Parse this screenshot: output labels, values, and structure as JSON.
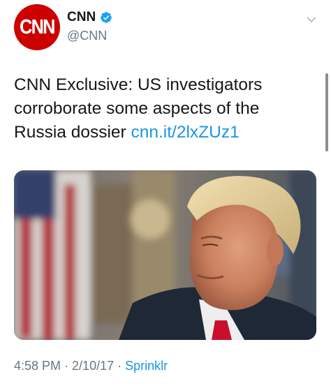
{
  "account": {
    "logo_text": "CNN",
    "name": "CNN",
    "handle": "@CNN"
  },
  "tweet": {
    "text": "CNN Exclusive: US investigators corroborate some aspects of the Russia dossier ",
    "link": "cnn.it/2lxZUz1"
  },
  "meta": {
    "time": "4:58 PM",
    "separator1": " · ",
    "date": "2/10/17",
    "separator2": " · ",
    "source": "Sprinklr"
  },
  "colors": {
    "cnn_red": "#cc0000",
    "link_blue": "#1b95e0",
    "verified_blue": "#1da1f2",
    "muted_gray": "#657786"
  },
  "icons": {
    "verified": "verified-badge-icon",
    "menu": "chevron-down-icon"
  }
}
